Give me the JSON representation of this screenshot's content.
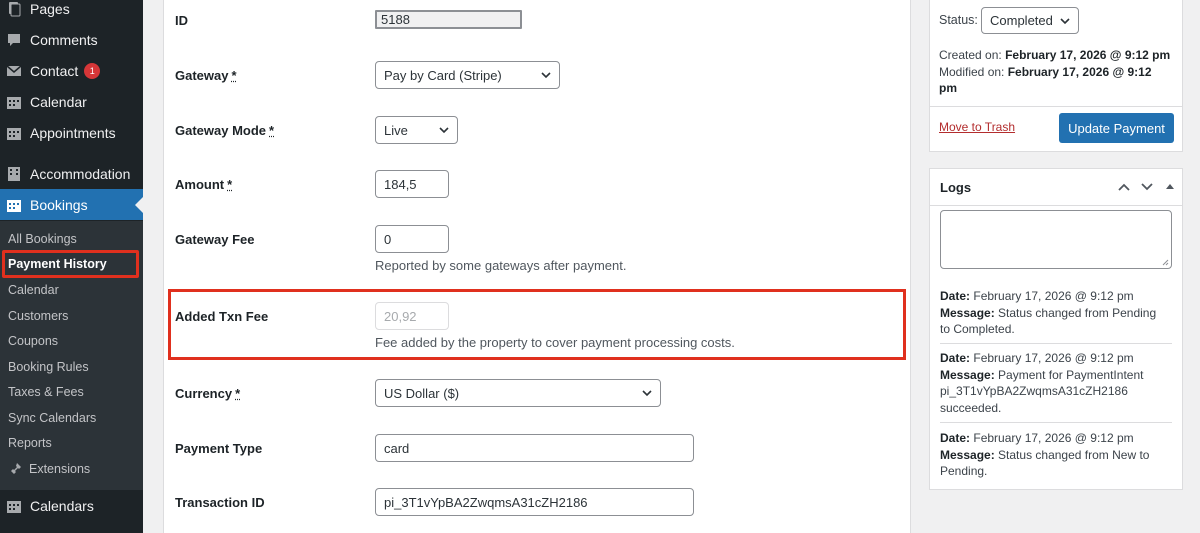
{
  "sidebar": {
    "items": [
      {
        "label": "Pages",
        "icon": "pages-icon"
      },
      {
        "label": "Comments",
        "icon": "comments-icon"
      },
      {
        "label": "Contact",
        "icon": "mail-icon",
        "badge": "1"
      },
      {
        "label": "Calendar",
        "icon": "calendar-icon"
      },
      {
        "label": "Appointments",
        "icon": "calendar-icon"
      },
      {
        "label": "Accommodation",
        "icon": "building-icon"
      },
      {
        "label": "Bookings",
        "icon": "calendar-icon"
      },
      {
        "label": "Calendars",
        "icon": "calendar-icon"
      }
    ],
    "submenu": [
      "All Bookings",
      "Payment History",
      "Calendar",
      "Customers",
      "Coupons",
      "Booking Rules",
      "Taxes & Fees",
      "Sync Calendars",
      "Reports",
      "Extensions"
    ]
  },
  "form": {
    "id": {
      "label": "ID",
      "value": "5188"
    },
    "gateway": {
      "label": "Gateway",
      "value": "Pay by Card (Stripe)"
    },
    "gateway_mode": {
      "label": "Gateway Mode",
      "value": "Live"
    },
    "amount": {
      "label": "Amount",
      "value": "184,5"
    },
    "gateway_fee": {
      "label": "Gateway Fee",
      "value": "0",
      "description": "Reported by some gateways after payment."
    },
    "added_txn_fee": {
      "label": "Added Txn Fee",
      "value": "20,92",
      "description": "Fee added by the property to cover payment processing costs."
    },
    "currency": {
      "label": "Currency",
      "value": "US Dollar ($)"
    },
    "payment_type": {
      "label": "Payment Type",
      "value": "card"
    },
    "transaction_id": {
      "label": "Transaction ID",
      "value": "pi_3T1vYpBA2ZwqmsA31cZH2186"
    },
    "required_mark": "*"
  },
  "publish": {
    "status_label": "Status:",
    "status_value": "Completed",
    "created_label": "Created on:",
    "created_value": "February 17, 2026 @ 9:12 pm",
    "modified_label": "Modified on:",
    "modified_value_1": "February 17, 2026 @ 9:12",
    "modified_value_2": "pm",
    "trash": "Move to Trash",
    "update": "Update Payment"
  },
  "logs": {
    "title": "Logs",
    "date_label": "Date:",
    "message_label": "Message:",
    "entries": [
      {
        "date": "February 17, 2026 @ 9:12 pm",
        "message_1": "Status changed from Pending",
        "message_2": "to Completed."
      },
      {
        "date": "February 17, 2026 @ 9:12 pm",
        "message_1": "Payment for PaymentIntent",
        "message_2": "pi_3T1vYpBA2ZwqmsA31cZH2186",
        "message_3": "succeeded."
      },
      {
        "date": "February 17, 2026 @ 9:12 pm",
        "message_1": "Status changed from New to",
        "message_2": "Pending."
      }
    ]
  },
  "colors": {
    "accent": "#2271b1",
    "highlight": "#e0301e",
    "sidebar": "#1d2327"
  }
}
